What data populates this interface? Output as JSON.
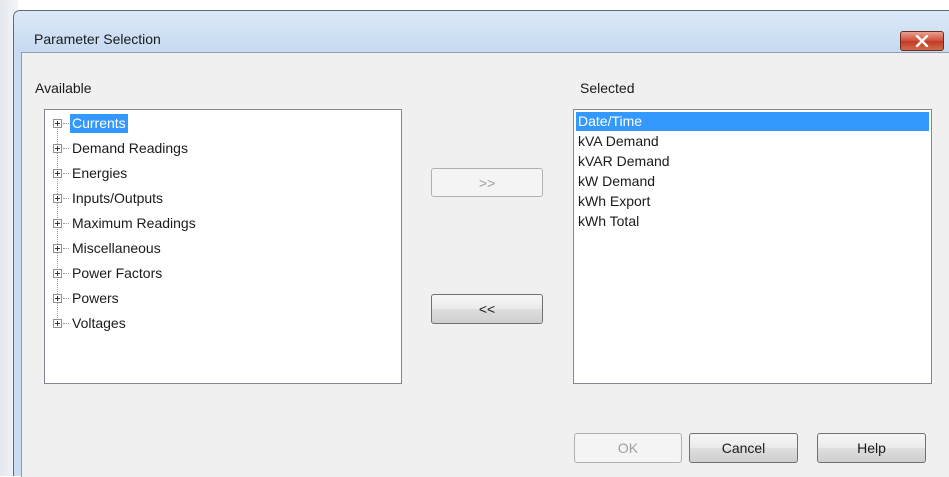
{
  "dialog": {
    "title": "Parameter Selection"
  },
  "available": {
    "label": "Available",
    "items": [
      {
        "label": "Currents",
        "selected": true
      },
      {
        "label": "Demand Readings"
      },
      {
        "label": "Energies"
      },
      {
        "label": "Inputs/Outputs"
      },
      {
        "label": "Maximum Readings"
      },
      {
        "label": "Miscellaneous"
      },
      {
        "label": "Power Factors"
      },
      {
        "label": "Powers"
      },
      {
        "label": "Voltages"
      }
    ]
  },
  "selected": {
    "label": "Selected",
    "items": [
      {
        "label": "Date/Time",
        "selected": true
      },
      {
        "label": "kVA Demand"
      },
      {
        "label": "kVAR Demand"
      },
      {
        "label": "kW Demand"
      },
      {
        "label": "kWh Export"
      },
      {
        "label": "kWh Total"
      }
    ]
  },
  "buttons": {
    "add": ">>",
    "remove": "<<",
    "ok": "OK",
    "cancel": "Cancel",
    "help": "Help"
  },
  "colors": {
    "selection": "#3399ff",
    "close_button": "#c94a34"
  },
  "icons": {
    "close": "close-icon",
    "expand": "expand-plus-icon"
  }
}
